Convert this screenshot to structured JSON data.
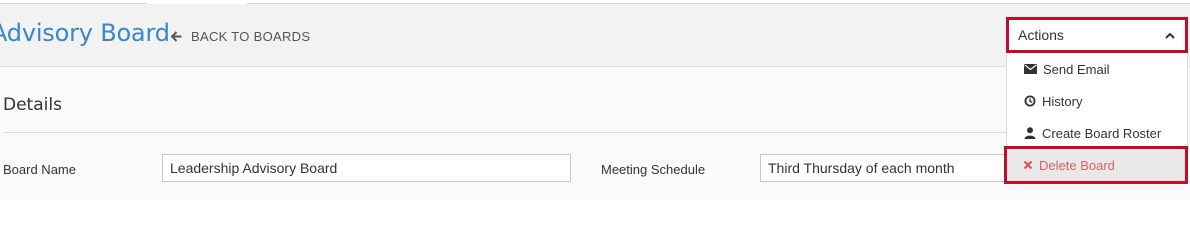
{
  "header": {
    "title": "Advisory Board",
    "back_label": "BACK TO BOARDS"
  },
  "details": {
    "section_title": "Details",
    "board_name_label": "Board Name",
    "board_name_value": "Leadership Advisory Board",
    "meeting_schedule_label": "Meeting Schedule",
    "meeting_schedule_value": "Third Thursday of each month"
  },
  "actions": {
    "label": "Actions",
    "expanded_icon": "chevron-up-icon",
    "items": [
      {
        "label": "Send Email",
        "icon": "envelope-icon"
      },
      {
        "label": "History",
        "icon": "history-icon"
      },
      {
        "label": "Create Board Roster",
        "icon": "user-icon"
      },
      {
        "label": "Delete Board",
        "icon": "close-icon",
        "highlighted": true
      }
    ]
  },
  "colors": {
    "title_blue": "#3a87c9",
    "highlight_red": "#c40c2a",
    "delete_text": "#e06060",
    "header_bg": "#f2f2f2"
  }
}
